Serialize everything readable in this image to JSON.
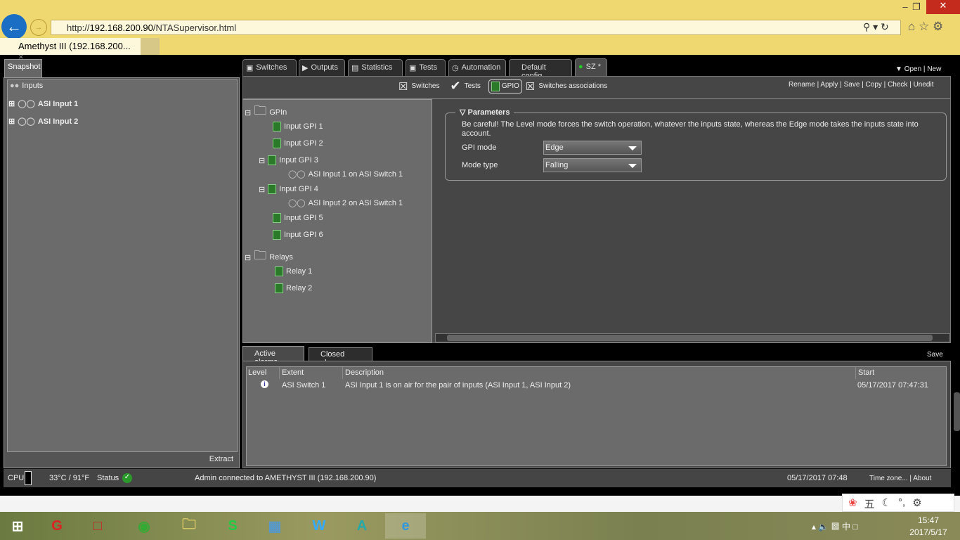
{
  "browser": {
    "url_prefix": "http://",
    "url_host": "192.168.200.90",
    "url_path": "/NTASupervisor.html",
    "tab_title": "Amethyst III (192.168.200...",
    "tab_close": "×"
  },
  "left": {
    "tab": "Snapshot",
    "root": "Inputs",
    "items": [
      "ASI Input 1",
      "ASI Input 2"
    ],
    "extract": "Extract"
  },
  "tabs": [
    "Switches",
    "Outputs",
    "Statistics",
    "Tests",
    "Automation",
    "Default config",
    "SZ *"
  ],
  "open_new": [
    "Open",
    "New"
  ],
  "subtoolbar": [
    "Switches",
    "Tests",
    "GPIO",
    "Switches associations"
  ],
  "actions": [
    "Rename",
    "Apply",
    "Save",
    "Copy",
    "Check",
    "Unedit"
  ],
  "tree": {
    "gpin": "GPIn",
    "gpis": [
      "Input GPI 1",
      "Input GPI 2",
      "Input GPI 3",
      "ASI Input 1 on ASI Switch 1",
      "Input GPI 4",
      "ASI Input 2 on ASI Switch 1",
      "Input GPI 5",
      "Input GPI 6"
    ],
    "relays": "Relays",
    "relay_items": [
      "Relay 1",
      "Relay 2"
    ]
  },
  "params": {
    "title": "Parameters",
    "warning": "Be careful! The Level mode forces the switch operation, whatever the inputs state, whereas the Edge mode takes the inputs state into account.",
    "gpi_mode_label": "GPI mode",
    "gpi_mode": "Edge",
    "mode_type_label": "Mode type",
    "mode_type": "Falling"
  },
  "alarms": {
    "tabs": [
      "Active alarms",
      "Closed alarms"
    ],
    "save": "Save",
    "columns": [
      "Level",
      "Extent",
      "Description",
      "Start"
    ],
    "rows": [
      {
        "level": "info",
        "extent": "ASI Switch 1",
        "description": "ASI Input 1 is on air for the pair of inputs (ASI Input 1, ASI Input 2)",
        "start": "05/17/2017 07:47:31"
      }
    ]
  },
  "status": {
    "cpu": "CPU",
    "temp": "33°C / 91°F",
    "status": "Status",
    "connection": "Admin connected to AMETHYST III (192.168.200.90)",
    "datetime": "05/17/2017 07:48",
    "timezone": "Time zone...",
    "about": "About"
  },
  "taskbar": {
    "time": "15:47",
    "date": "2017/5/17",
    "ime": "五",
    "lang": "中"
  },
  "colors": {
    "accent_green": "#2a9a2a",
    "title_bar": "#f0d870",
    "panel": "#6b6b6b"
  }
}
